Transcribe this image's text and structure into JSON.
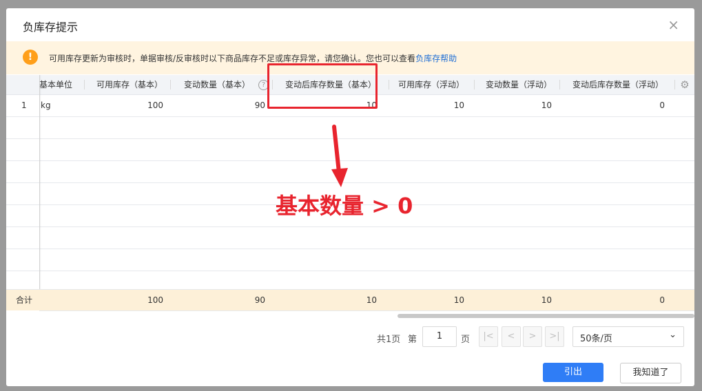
{
  "dialog": {
    "title": "负库存提示",
    "close_glyph": "×"
  },
  "alert": {
    "icon": "exclamation-icon",
    "message": "可用库存更新为审核时，单据审核/反审核时以下商品库存不足或库存异常，请您确认。您也可以查看",
    "link": "负库存帮助"
  },
  "table": {
    "headers": {
      "base_unit": "基本单位",
      "avail_base": "可用库存（基本）",
      "change_base": "变动数量（基本）",
      "after_base": "变动后库存数量（基本）",
      "avail_float": "可用库存（浮动）",
      "change_float": "变动数量（浮动）",
      "after_float": "变动后库存数量（浮动）"
    },
    "rows": [
      {
        "index": "1",
        "base_unit": "kg",
        "avail_base": "100",
        "change_base": "90",
        "after_base": "10",
        "avail_float": "10",
        "change_float": "10",
        "after_float": "0"
      }
    ],
    "total": {
      "label": "合计",
      "avail_base": "100",
      "change_base": "90",
      "after_base": "10",
      "avail_float": "10",
      "change_float": "10",
      "after_float": "0"
    }
  },
  "pagination": {
    "total_pages": "共1页",
    "page_label_before": "第",
    "current_page": "1",
    "page_label_after": "页",
    "first_glyph": "|<",
    "prev_glyph": "<",
    "next_glyph": ">",
    "last_glyph": ">|",
    "page_size": "50条/页"
  },
  "buttons": {
    "export": "引出",
    "acknowledge": "我知道了"
  },
  "annotation": {
    "text": "基本数量 > 0",
    "color": "#e8242e"
  },
  "colors": {
    "primary": "#2f7df6",
    "alert_bg": "#fff4e0",
    "warning_icon": "#ff9f1a",
    "total_bg": "#fdf0d8"
  }
}
